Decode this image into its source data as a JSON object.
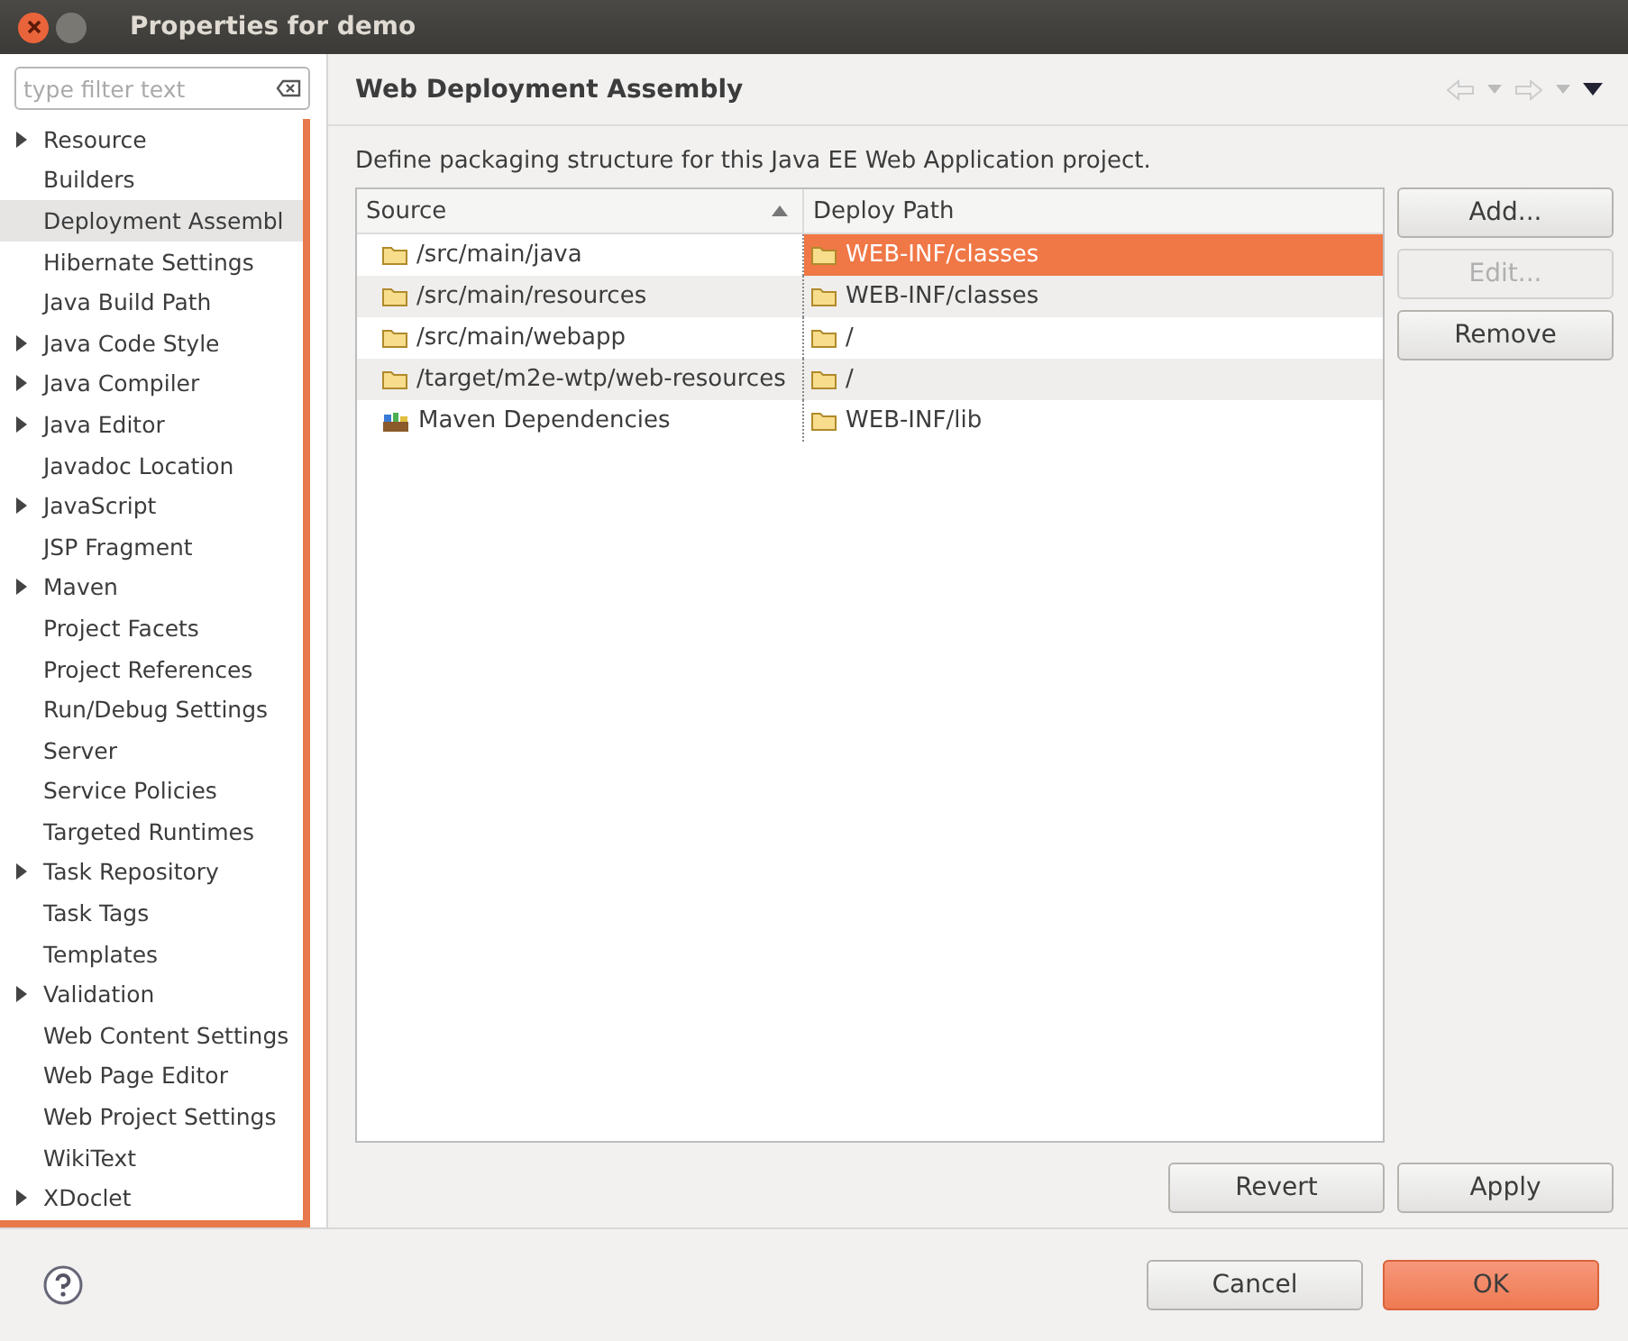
{
  "window": {
    "title": "Properties for demo"
  },
  "filter": {
    "placeholder": "type filter text"
  },
  "sidebar": {
    "items": [
      {
        "label": "Resource",
        "expandable": true,
        "selected": false
      },
      {
        "label": "Builders",
        "expandable": false,
        "selected": false
      },
      {
        "label": "Deployment Assembl",
        "expandable": false,
        "selected": true
      },
      {
        "label": "Hibernate Settings",
        "expandable": false,
        "selected": false
      },
      {
        "label": "Java Build Path",
        "expandable": false,
        "selected": false
      },
      {
        "label": "Java Code Style",
        "expandable": true,
        "selected": false
      },
      {
        "label": "Java Compiler",
        "expandable": true,
        "selected": false
      },
      {
        "label": "Java Editor",
        "expandable": true,
        "selected": false
      },
      {
        "label": "Javadoc Location",
        "expandable": false,
        "selected": false
      },
      {
        "label": "JavaScript",
        "expandable": true,
        "selected": false
      },
      {
        "label": "JSP Fragment",
        "expandable": false,
        "selected": false
      },
      {
        "label": "Maven",
        "expandable": true,
        "selected": false
      },
      {
        "label": "Project Facets",
        "expandable": false,
        "selected": false
      },
      {
        "label": "Project References",
        "expandable": false,
        "selected": false
      },
      {
        "label": "Run/Debug Settings",
        "expandable": false,
        "selected": false
      },
      {
        "label": "Server",
        "expandable": false,
        "selected": false
      },
      {
        "label": "Service Policies",
        "expandable": false,
        "selected": false
      },
      {
        "label": "Targeted Runtimes",
        "expandable": false,
        "selected": false
      },
      {
        "label": "Task Repository",
        "expandable": true,
        "selected": false
      },
      {
        "label": "Task Tags",
        "expandable": false,
        "selected": false
      },
      {
        "label": "Templates",
        "expandable": false,
        "selected": false
      },
      {
        "label": "Validation",
        "expandable": true,
        "selected": false
      },
      {
        "label": "Web Content Settings",
        "expandable": false,
        "selected": false
      },
      {
        "label": "Web Page Editor",
        "expandable": false,
        "selected": false
      },
      {
        "label": "Web Project Settings",
        "expandable": false,
        "selected": false
      },
      {
        "label": "WikiText",
        "expandable": false,
        "selected": false
      },
      {
        "label": "XDoclet",
        "expandable": true,
        "selected": false
      }
    ]
  },
  "page": {
    "title": "Web Deployment Assembly",
    "description": "Define packaging structure for this Java EE Web Application project."
  },
  "table": {
    "columns": [
      "Source",
      "Deploy Path"
    ],
    "rows": [
      {
        "source": "/src/main/java",
        "kind": "folder",
        "deploy_path": "WEB-INF/classes",
        "selected": true
      },
      {
        "source": "/src/main/resources",
        "kind": "folder",
        "deploy_path": "WEB-INF/classes",
        "selected": false
      },
      {
        "source": "/src/main/webapp",
        "kind": "folder",
        "deploy_path": "/",
        "selected": false
      },
      {
        "source": "/target/m2e-wtp/web-resources",
        "kind": "folder",
        "deploy_path": "/",
        "selected": false
      },
      {
        "source": "Maven Dependencies",
        "kind": "library",
        "deploy_path": "WEB-INF/lib",
        "selected": false
      }
    ]
  },
  "side_buttons": [
    {
      "label": "Add...",
      "disabled": false
    },
    {
      "label": "Edit...",
      "disabled": true
    },
    {
      "label": "Remove",
      "disabled": false
    }
  ],
  "page_buttons": [
    "Revert",
    "Apply"
  ],
  "dialog_buttons": [
    {
      "label": "Cancel",
      "default": false
    },
    {
      "label": "OK",
      "default": true
    }
  ]
}
